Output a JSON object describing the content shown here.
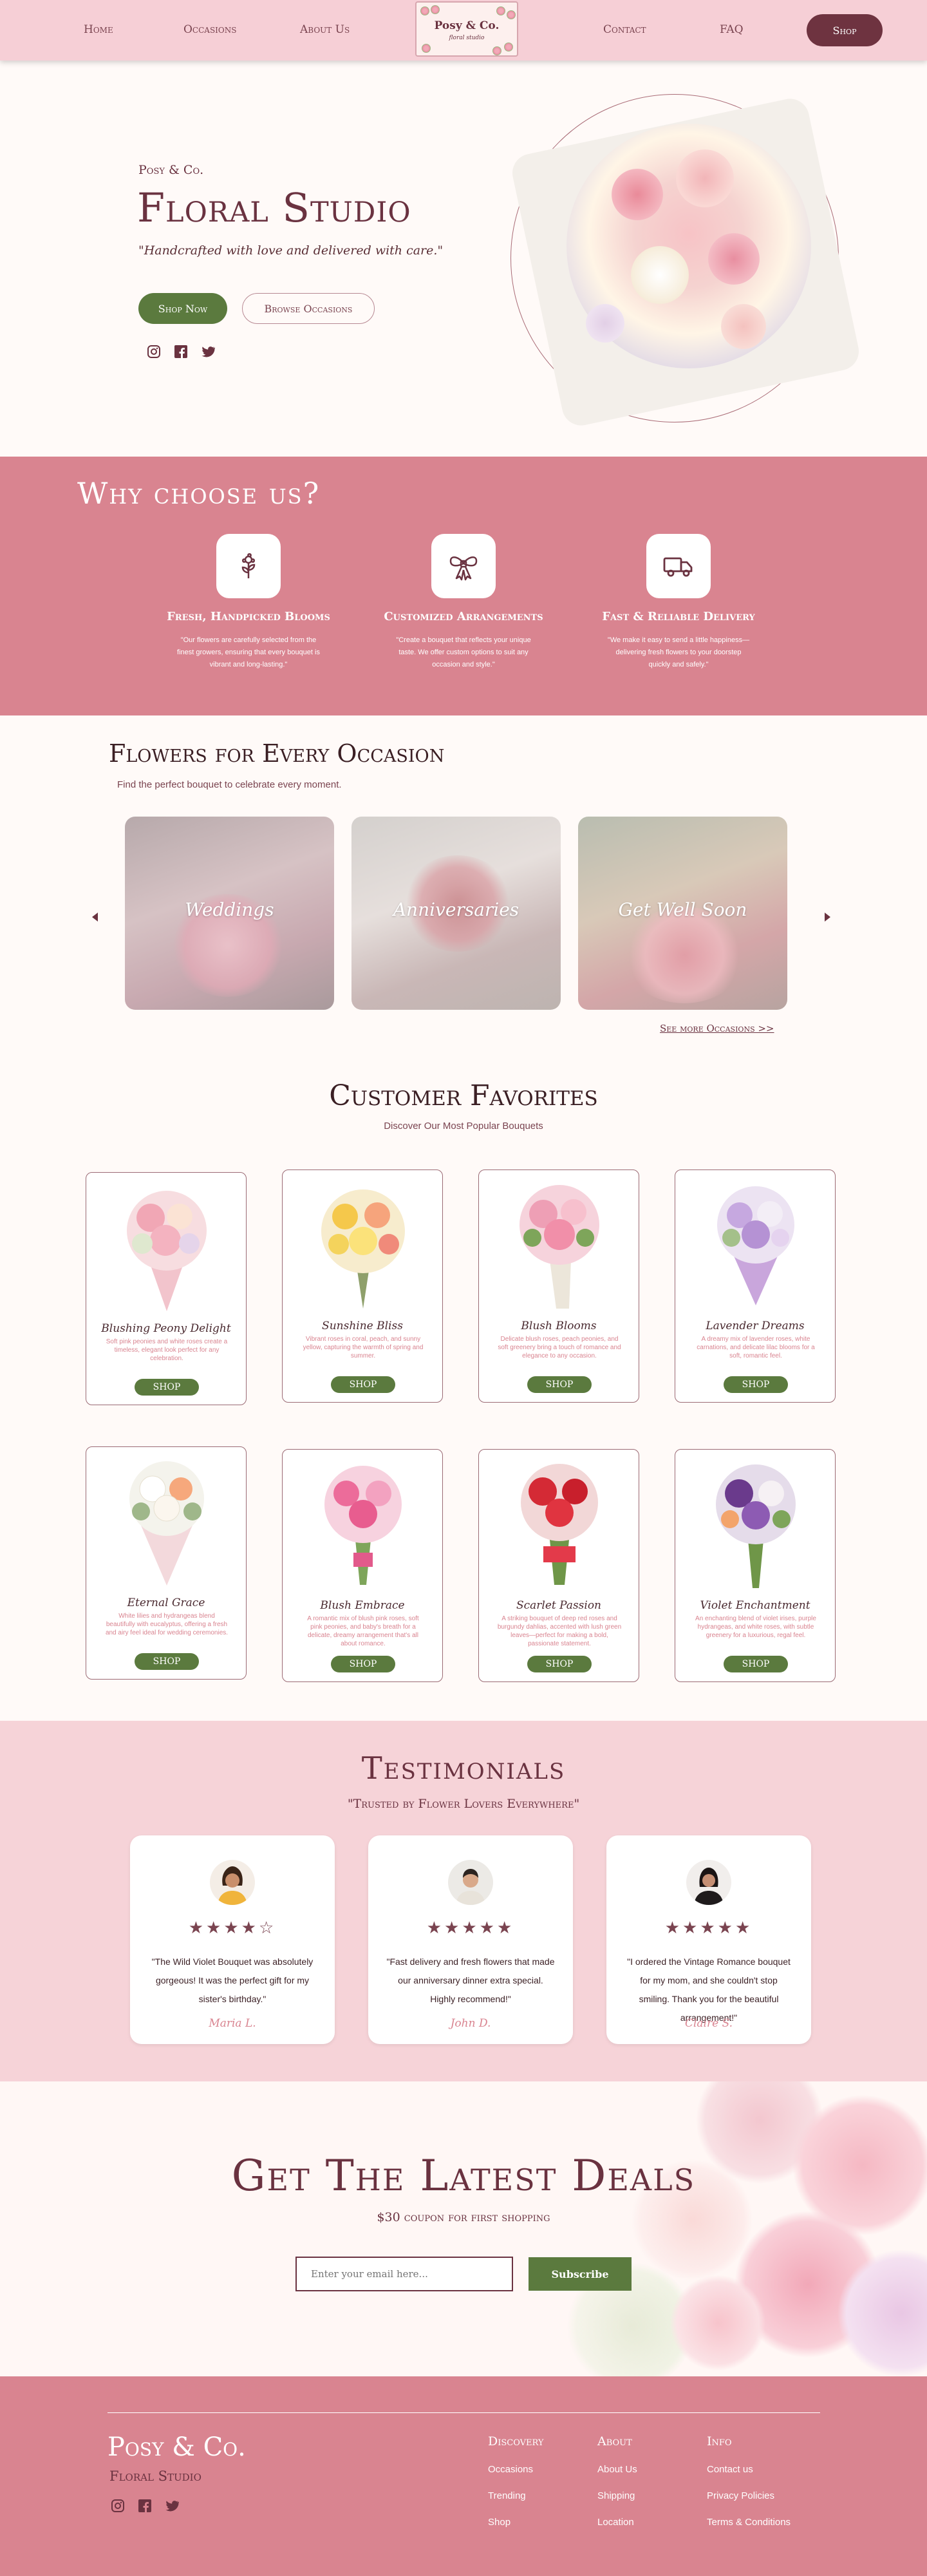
{
  "nav": {
    "links": [
      "Home",
      "Occasions",
      "About Us",
      "Contact",
      "FAQ"
    ],
    "logo_title": "Posy & Co.",
    "logo_sub": "floral studio",
    "shop_label": "Shop"
  },
  "hero": {
    "brand": "Posy & Co.",
    "title": "Floral Studio",
    "tagline": "\"Handcrafted with love and delivered with care.\"",
    "primary_btn": "Shop Now",
    "secondary_btn": "Browse Occasions",
    "social_icons": [
      "instagram-icon",
      "facebook-icon",
      "twitter-icon"
    ]
  },
  "why": {
    "title": "Why choose us?",
    "features": [
      {
        "icon": "flower-icon",
        "title": "Fresh, Handpicked Blooms",
        "text": "\"Our flowers are carefully selected from the finest growers, ensuring that every bouquet is vibrant and long-lasting.\""
      },
      {
        "icon": "bow-icon",
        "title": "Customized Arrangements",
        "text": "\"Create a bouquet that reflects your unique taste. We offer custom options to suit any occasion and style.\""
      },
      {
        "icon": "truck-icon",
        "title": "Fast & Reliable Delivery",
        "text": "\"We make it easy to send a little happiness—delivering fresh flowers to your doorstep quickly and safely.\""
      }
    ]
  },
  "occasions": {
    "title": "Flowers for Every Occasion",
    "subtitle": "Find the perfect bouquet to celebrate every moment.",
    "cards": [
      "Weddings",
      "Anniversaries",
      "Get Well Soon"
    ],
    "see_more": "See more Occasions >>"
  },
  "favorites": {
    "title": "Customer Favorites",
    "subtitle": "Discover Our Most Popular Bouquets",
    "button_label": "SHOP",
    "products": [
      {
        "name": "Blushing Peony Delight",
        "desc": "Soft pink peonies and white roses create a timeless, elegant look perfect for any celebration."
      },
      {
        "name": "Sunshine Bliss",
        "desc": "Vibrant roses in coral, peach, and sunny yellow, capturing the warmth of spring and summer."
      },
      {
        "name": "Blush Blooms",
        "desc": "Delicate blush roses, peach peonies, and soft greenery bring a touch of romance and elegance to any occasion."
      },
      {
        "name": "Lavender Dreams",
        "desc": "A dreamy mix of lavender roses, white carnations, and delicate lilac blooms for a soft, romantic feel."
      },
      {
        "name": "Eternal Grace",
        "desc": "White lilies and hydrangeas blend beautifully with eucalyptus, offering a fresh and airy feel ideal for wedding ceremonies."
      },
      {
        "name": "Blush Embrace",
        "desc": "A romantic mix of blush pink roses, soft pink peonies, and baby's breath for a delicate, dreamy arrangement that's all about romance."
      },
      {
        "name": "Scarlet Passion",
        "desc": "A striking bouquet of deep red roses and burgundy dahlias, accented with lush green leaves—perfect for making a bold, passionate statement."
      },
      {
        "name": "Violet Enchantment",
        "desc": "An enchanting blend of violet irises, purple hydrangeas, and white roses, with subtle greenery for a luxurious, regal feel."
      }
    ]
  },
  "testimonials": {
    "title": "Testimonials",
    "subtitle": "\"Trusted by Flower Lovers Everywhere\"",
    "items": [
      {
        "stars": "★★★★☆",
        "quote": "\"The Wild Violet Bouquet was absolutely gorgeous! It was the perfect gift for my sister's birthday.\"",
        "name": "Maria L."
      },
      {
        "stars": "★★★★★",
        "quote": "\"Fast delivery and fresh flowers that made our anniversary dinner extra special. Highly recommend!\"",
        "name": "John D."
      },
      {
        "stars": "★★★★★",
        "quote": "\"I ordered the Vintage Romance bouquet for my mom, and she couldn't stop smiling. Thank you for the beautiful arrangement!\"",
        "name": "Claire S."
      }
    ]
  },
  "deals": {
    "title": "Get The Latest Deals",
    "subtitle": "$30 coupon for first shopping",
    "email_placeholder": "Enter your email here...",
    "subscribe_label": "Subscribe"
  },
  "footer": {
    "brand": "Posy & Co.",
    "studio": "Floral Studio",
    "columns": [
      {
        "head": "Discovery",
        "links": [
          "Occasions",
          "Trending",
          "Shop"
        ]
      },
      {
        "head": "About",
        "links": [
          "About Us",
          "Shipping",
          "Location"
        ]
      },
      {
        "head": "Info",
        "links": [
          "Contact us",
          "Privacy Policies",
          "Terms & Conditions"
        ]
      }
    ]
  },
  "colors": {
    "primary": "#d98490",
    "nav_bg": "#f6cfd6",
    "accent_dark": "#6a3240",
    "green": "#5b7a3e"
  }
}
